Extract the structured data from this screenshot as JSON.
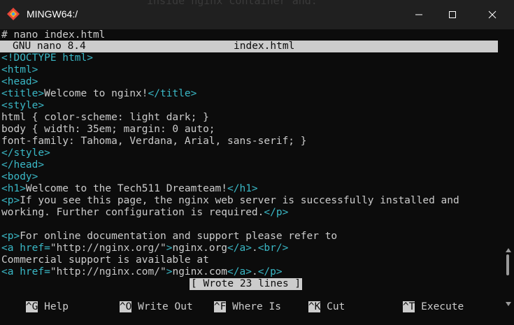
{
  "window": {
    "title": "MINGW64:/",
    "bleed_text": "inside nginx container and:"
  },
  "terminal": {
    "prompt_line": "# nano index.html",
    "nano_header": {
      "version": "GNU nano 8.4",
      "filename": "index.html"
    },
    "lines": [
      [
        {
          "t": "<!DOCTYPE html>",
          "c": "tag"
        }
      ],
      [
        {
          "t": "<html>",
          "c": "tag"
        }
      ],
      [
        {
          "t": "<head>",
          "c": "tag"
        }
      ],
      [
        {
          "t": "<title>",
          "c": "tag"
        },
        {
          "t": "Welcome to nginx!",
          "c": ""
        },
        {
          "t": "</title>",
          "c": "tag"
        }
      ],
      [
        {
          "t": "<style>",
          "c": "tag"
        }
      ],
      [
        {
          "t": "html { color-scheme: light dark; }",
          "c": ""
        }
      ],
      [
        {
          "t": "body { width: 35em; margin: 0 auto;",
          "c": ""
        }
      ],
      [
        {
          "t": "font-family: Tahoma, Verdana, Arial, sans-serif; }",
          "c": ""
        }
      ],
      [
        {
          "t": "</style>",
          "c": "tag"
        }
      ],
      [
        {
          "t": "</head>",
          "c": "tag"
        }
      ],
      [
        {
          "t": "<body>",
          "c": "tag"
        }
      ],
      [
        {
          "t": "<h1>",
          "c": "tag"
        },
        {
          "t": "Welcome to the Tech511 Dreamteam!",
          "c": ""
        },
        {
          "t": "</h1>",
          "c": "tag"
        }
      ],
      [
        {
          "t": "<p>",
          "c": "tag"
        },
        {
          "t": "If you see this page, the nginx web server is successfully installed and",
          "c": ""
        }
      ],
      [
        {
          "t": "working. Further configuration is required.",
          "c": ""
        },
        {
          "t": "</p>",
          "c": "tag"
        }
      ],
      [
        {
          "t": "",
          "c": ""
        }
      ],
      [
        {
          "t": "<p>",
          "c": "tag"
        },
        {
          "t": "For online documentation and support please refer to",
          "c": ""
        }
      ],
      [
        {
          "t": "<a ",
          "c": "tag"
        },
        {
          "t": "href=",
          "c": "tag"
        },
        {
          "t": "\"http://nginx.org/\"",
          "c": "str"
        },
        {
          "t": ">",
          "c": "tag"
        },
        {
          "t": "nginx.org",
          "c": ""
        },
        {
          "t": "</a>",
          "c": "tag"
        },
        {
          "t": ".",
          "c": ""
        },
        {
          "t": "<br/>",
          "c": "tag"
        }
      ],
      [
        {
          "t": "Commercial support is available at",
          "c": ""
        }
      ],
      [
        {
          "t": "<a ",
          "c": "tag"
        },
        {
          "t": "href=",
          "c": "tag"
        },
        {
          "t": "\"http://nginx.com/\"",
          "c": "str"
        },
        {
          "t": ">",
          "c": "tag"
        },
        {
          "t": "nginx.com",
          "c": ""
        },
        {
          "t": "</a>",
          "c": "tag"
        },
        {
          "t": ".",
          "c": ""
        },
        {
          "t": "</p>",
          "c": "tag"
        }
      ]
    ],
    "status_message": "[ Wrote 23 lines ]",
    "shortcuts": [
      {
        "key": "^G",
        "label": " Help"
      },
      {
        "key": "^O",
        "label": " Write Out"
      },
      {
        "key": "^F",
        "label": " Where Is"
      },
      {
        "key": "^K",
        "label": " Cut"
      },
      {
        "key": "^T",
        "label": " Execute"
      }
    ]
  },
  "colors": {
    "terminal_bg": "#0c0c0c",
    "text": "#cccccc",
    "tag": "#3ab8c6",
    "titlebar_bg": "#202020"
  }
}
